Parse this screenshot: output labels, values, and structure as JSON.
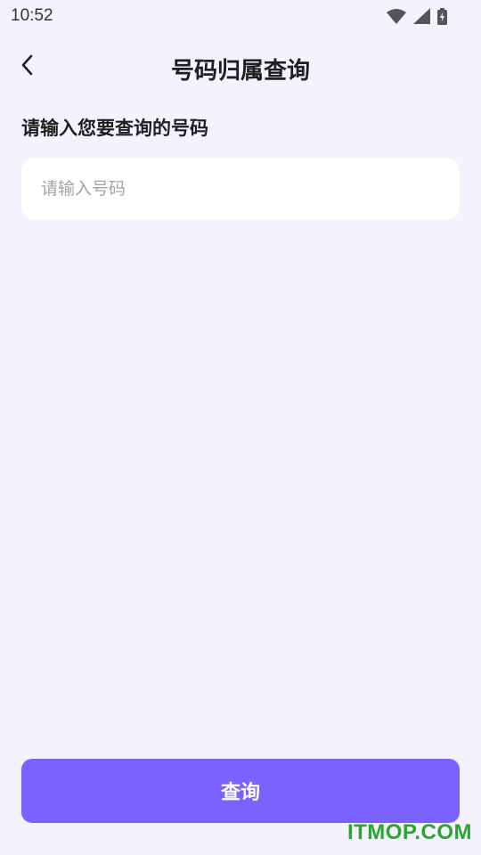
{
  "status_bar": {
    "time": "10:52",
    "icons": [
      "wifi-icon",
      "cell-signal-icon",
      "battery-charging-icon"
    ]
  },
  "app_bar": {
    "back_icon": "chevron-left-icon",
    "title": "号码归属查询"
  },
  "form": {
    "label": "请输入您要查询的号码",
    "input_value": "",
    "input_placeholder": "请输入号码"
  },
  "actions": {
    "query_label": "查询"
  },
  "watermark": {
    "text": "ITMOP.COM"
  },
  "colors": {
    "background": "#f4f2fd",
    "accent": "#7a62ff",
    "input_bg": "#ffffff",
    "watermark": "#2aa52d"
  }
}
